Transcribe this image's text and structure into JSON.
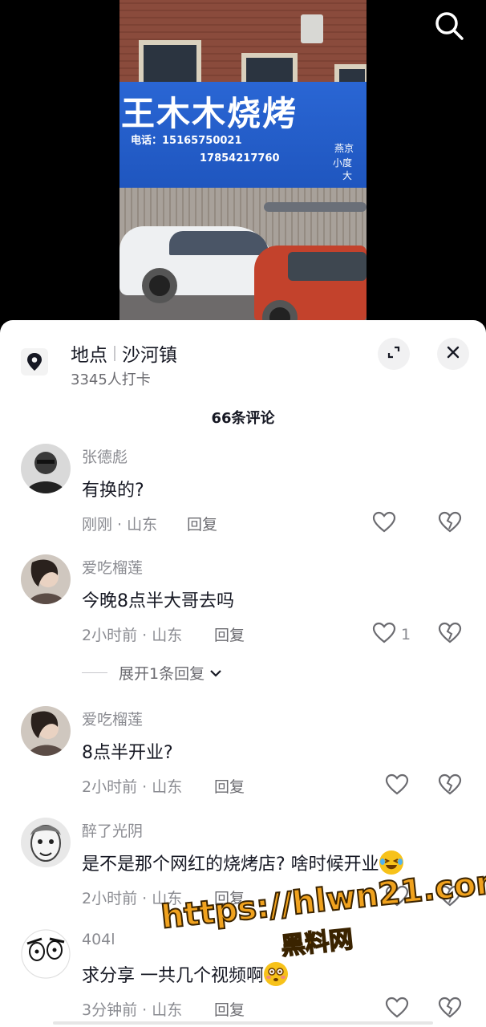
{
  "video": {
    "sign_title": "王木木烧烤",
    "sign_phone_1": "电话：15165750021",
    "sign_phone_2": "17854217760",
    "sign_side_1": "燕京",
    "sign_side_2": "小度",
    "sign_side_3": "大",
    "search_icon": "search-icon"
  },
  "location": {
    "label": "地点",
    "name": "沙河镇",
    "checkins": "3345人打卡",
    "pin_icon": "location-pin-icon",
    "expand_icon": "expand-icon",
    "close_icon": "close-icon"
  },
  "comment_count": "66条评论",
  "comments": [
    {
      "user": "张德彪",
      "text": "有换的?",
      "time": "刚刚 · 山东",
      "reply": "回复",
      "likes": ""
    },
    {
      "user": "爱吃榴莲",
      "text": "今晚8点半大哥去吗",
      "time": "2小时前 · 山东",
      "reply": "回复",
      "likes": "1"
    },
    {
      "user": "爱吃榴莲",
      "text": "8点半开业?",
      "time": "2小时前 · 山东",
      "reply": "回复",
      "likes": ""
    },
    {
      "user": "醉了光阴",
      "text": "是不是那个网红的烧烤店? 啥时候开业",
      "emoji": "laughing-emoji",
      "time": "2小时前 · 山东",
      "reply": "回复",
      "likes": ""
    },
    {
      "user": "404l",
      "text": "求分享 一共几个视频啊",
      "emoji": "flushed-emoji",
      "time": "3分钟前 · 山东",
      "reply": "回复",
      "likes": ""
    }
  ],
  "expand_replies": "展开1条回复",
  "watermark": {
    "line1": "https://hlwn21.com",
    "line2": "黑料网"
  },
  "colors": {
    "sign_blue": "#2a66d4",
    "text_primary": "#161823",
    "text_secondary": "#8a8b91",
    "watermark": "#f0a21e"
  }
}
